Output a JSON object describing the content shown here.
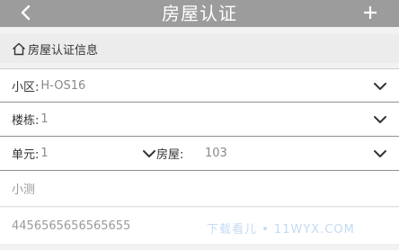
{
  "header": {
    "title": "房屋认证",
    "back_icon": "chevron-left-icon",
    "add_icon": "plus-icon",
    "bg_color": "#9c9c9c"
  },
  "section": {
    "title": "房屋认证信息",
    "icon": "home-icon"
  },
  "form": {
    "community_label": "小区:",
    "community_value": "H-OS16",
    "building_label": "楼栋:",
    "building_value": "1",
    "unit_label": "单元:",
    "unit_value": "1",
    "room_label": "房屋:",
    "room_value": "103",
    "name_value": "小测",
    "id_value": "4456565656565655"
  },
  "watermark": "下载看儿 • 11WYX.COM"
}
